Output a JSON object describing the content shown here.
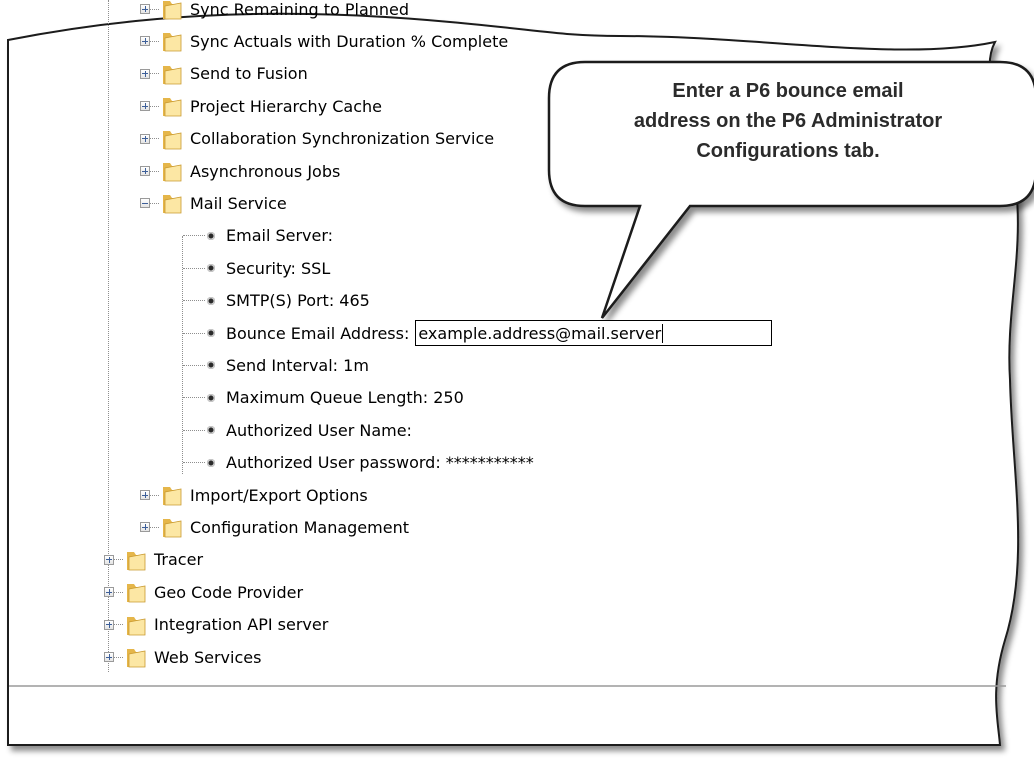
{
  "tree": {
    "nodes": [
      {
        "label": "Sync Remaining to Planned",
        "type": "folder",
        "state": "collapsed",
        "depth": 1
      },
      {
        "label": "Sync Actuals with Duration % Complete",
        "type": "folder",
        "state": "collapsed",
        "depth": 1
      },
      {
        "label": "Send to Fusion",
        "type": "folder",
        "state": "collapsed",
        "depth": 1
      },
      {
        "label": "Project Hierarchy Cache",
        "type": "folder",
        "state": "collapsed",
        "depth": 1
      },
      {
        "label": "Collaboration Synchronization Service",
        "type": "folder",
        "state": "collapsed",
        "depth": 1
      },
      {
        "label": "Asynchronous Jobs",
        "type": "folder",
        "state": "collapsed",
        "depth": 1
      },
      {
        "label": "Mail Service",
        "type": "folder",
        "state": "expanded",
        "depth": 1
      }
    ],
    "mail_service_settings": [
      {
        "label": "Email Server:"
      },
      {
        "label": "Security: SSL"
      },
      {
        "label": "SMTP(S) Port: 465"
      },
      {
        "label": "Bounce Email Address:",
        "input_value": "example.address@mail.server"
      },
      {
        "label": "Send Interval: 1m"
      },
      {
        "label": "Maximum Queue Length: 250"
      },
      {
        "label": "Authorized User Name:"
      },
      {
        "label": "Authorized User password: ***********"
      }
    ],
    "more_nodes": [
      {
        "label": "Import/Export Options",
        "type": "folder",
        "state": "collapsed",
        "depth": 1
      },
      {
        "label": "Configuration Management",
        "type": "folder",
        "state": "collapsed",
        "depth": 1
      }
    ],
    "root_nodes": [
      {
        "label": "Tracer",
        "type": "folder",
        "state": "collapsed",
        "depth": 0
      },
      {
        "label": "Geo Code Provider",
        "type": "folder",
        "state": "collapsed",
        "depth": 0
      },
      {
        "label": "Integration API server",
        "type": "folder",
        "state": "collapsed",
        "depth": 0
      },
      {
        "label": "Web Services",
        "type": "folder",
        "state": "collapsed",
        "depth": 0
      }
    ]
  },
  "callout": {
    "lines": [
      "Enter a P6 bounce email",
      "address on the P6 Administrator",
      "Configurations tab."
    ]
  },
  "icons": {
    "folder": "folder-icon",
    "expander_plus": "expand-plus-icon",
    "expander_minus": "collapse-minus-icon",
    "setting": "setting-bullet-icon"
  },
  "colors": {
    "folder_light": "#fce7a4",
    "folder_dark": "#e5b64a",
    "tree_lines": "#8e8e8e",
    "expander_glyph": "#3d5f99",
    "callout_text": "#2b2b2b"
  }
}
